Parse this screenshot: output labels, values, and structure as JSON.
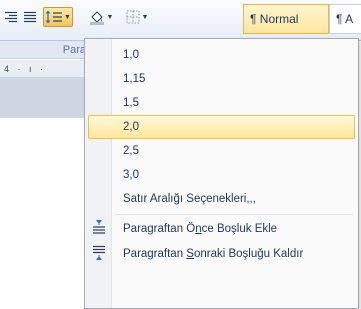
{
  "ribbon": {
    "align_right_icon": "align-right-icon",
    "justify_icon": "justify-icon",
    "line_spacing_icon": "line-spacing-icon",
    "shading_icon": "paint-bucket-icon",
    "borders_icon": "borders-icon",
    "styles": [
      {
        "label": "¶ Normal"
      },
      {
        "label": "¶ A"
      }
    ],
    "group_label": "Para",
    "ruler_text": "4 · ı ·"
  },
  "menu": {
    "spacing_options": [
      "1,0",
      "1,15",
      "1,5",
      "2,0",
      "2,5",
      "3,0"
    ],
    "selected_option": "2,0",
    "options_label": "Satır Aralığı Seçenekleri,,,",
    "add_before": {
      "prefix": "Paragraftan Ö",
      "mnemonic": "n",
      "suffix": "ce Boşluk Ekle"
    },
    "remove_after": {
      "prefix": "Paragraftan ",
      "mnemonic": "S",
      "suffix": "onraki Boşluğu Kaldır"
    }
  },
  "colors": {
    "highlight": "#ffe79b",
    "text": "#1e395b"
  }
}
